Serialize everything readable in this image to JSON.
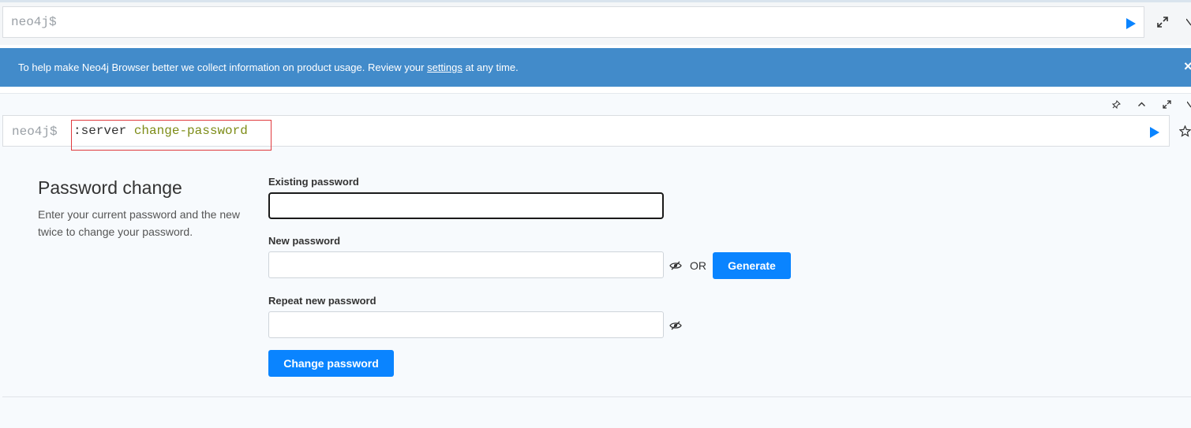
{
  "top_editor": {
    "prompt": "neo4j$"
  },
  "banner": {
    "text_before": "To help make Neo4j Browser better we collect information on product usage. Review your ",
    "link": "settings",
    "text_after": " at any time.",
    "close": "×"
  },
  "frame": {
    "prompt": "neo4j$",
    "command_keyword": ":server",
    "command_arg": "change-password"
  },
  "password_change": {
    "title": "Password change",
    "description": "Enter your current password and the new twice to change your password.",
    "existing_label": "Existing password",
    "existing_value": "",
    "new_label": "New password",
    "new_value": "",
    "or": "OR",
    "generate_button": "Generate",
    "repeat_label": "Repeat new password",
    "repeat_value": "",
    "submit_button": "Change password"
  },
  "colors": {
    "accent": "#0a84ff",
    "banner": "#428bca",
    "highlight": "#e03a3e",
    "command_arg": "#7d8c17"
  }
}
